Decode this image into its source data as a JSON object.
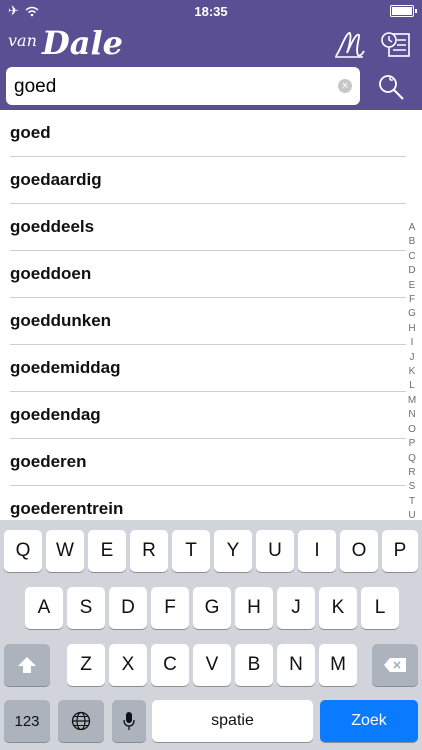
{
  "status": {
    "time": "18:35"
  },
  "app": {
    "logo_small": "van",
    "logo_big": "Dale"
  },
  "search": {
    "value": "goed",
    "placeholder": ""
  },
  "results": [
    "goed",
    "goedaardig",
    "goeddeels",
    "goeddoen",
    "goeddunken",
    "goedemiddag",
    "goedendag",
    "goederen",
    "goederentrein"
  ],
  "index_letters": [
    "A",
    "B",
    "C",
    "D",
    "E",
    "F",
    "G",
    "H",
    "I",
    "J",
    "K",
    "L",
    "M",
    "N",
    "O",
    "P",
    "Q",
    "R",
    "S",
    "T",
    "U"
  ],
  "keyboard": {
    "row1": [
      "Q",
      "W",
      "E",
      "R",
      "T",
      "Y",
      "U",
      "I",
      "O",
      "P"
    ],
    "row2": [
      "A",
      "S",
      "D",
      "F",
      "G",
      "H",
      "J",
      "K",
      "L"
    ],
    "row3": [
      "Z",
      "X",
      "C",
      "V",
      "B",
      "N",
      "M"
    ],
    "numbers_label": "123",
    "space_label": "spatie",
    "return_label": "Zoek"
  },
  "colors": {
    "header": "#5b4f94",
    "return_key": "#0a7aff"
  }
}
